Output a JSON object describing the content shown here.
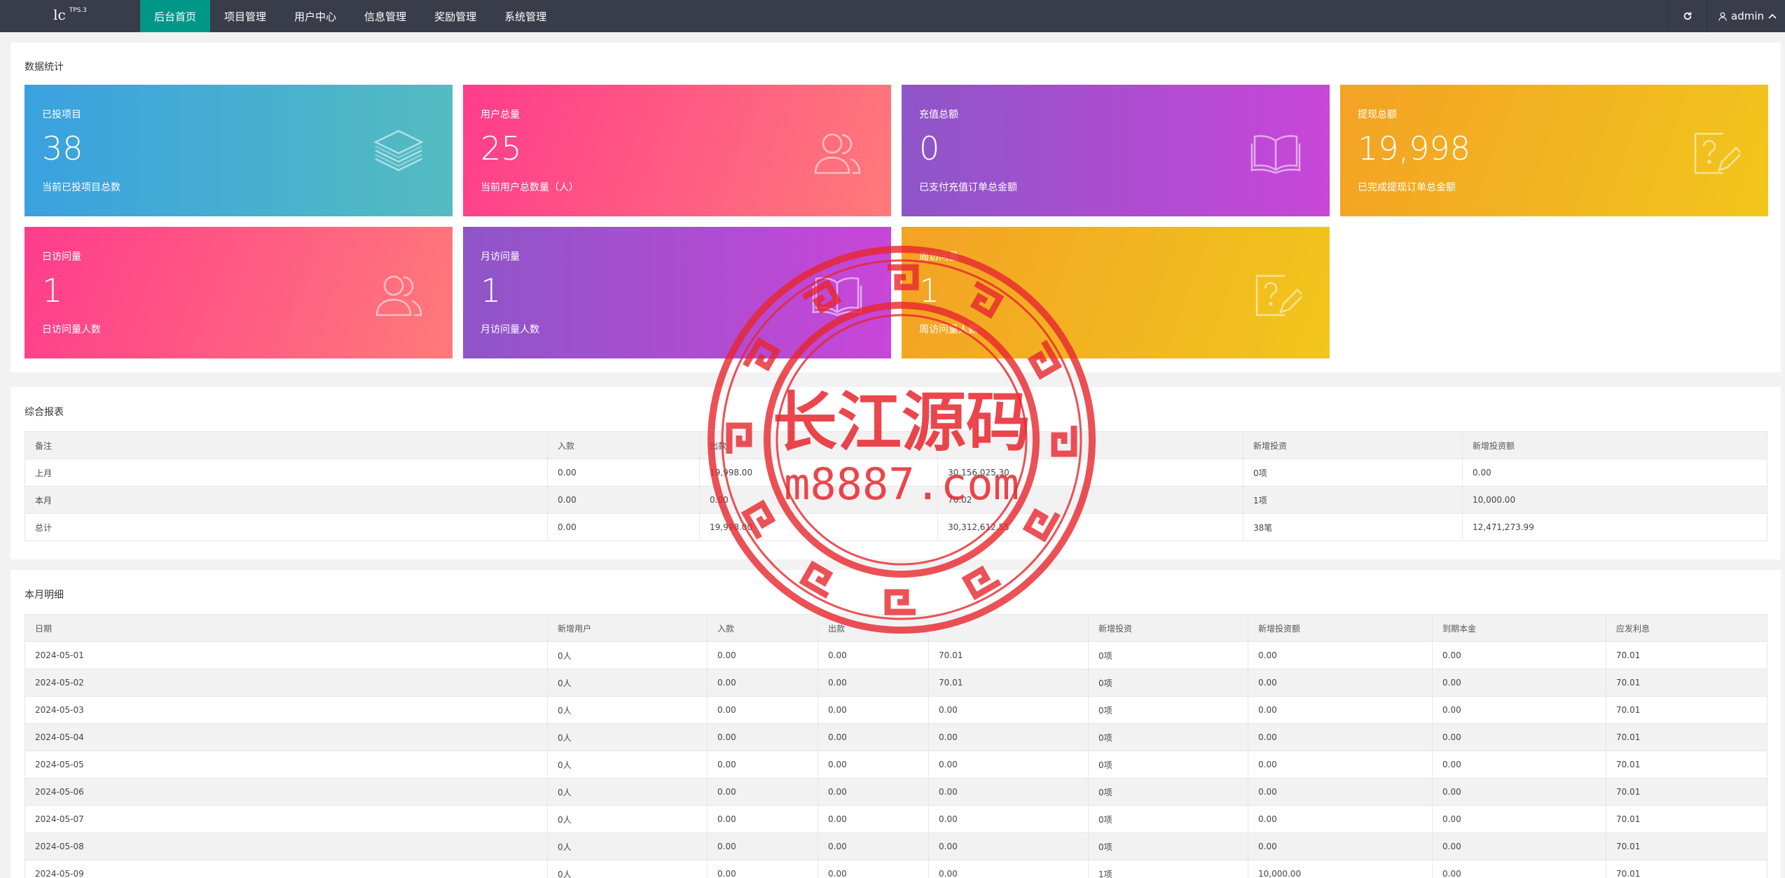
{
  "app": {
    "logo": "lc",
    "logo_sup": "TPS.3"
  },
  "nav": {
    "items": [
      "后台首页",
      "项目管理",
      "用户中心",
      "信息管理",
      "奖励管理",
      "系统管理"
    ]
  },
  "user": {
    "name": "admin"
  },
  "stats": {
    "title": "数据统计",
    "cards": [
      {
        "label": "已投项目",
        "value": "38",
        "desc": "当前已投项目总数"
      },
      {
        "label": "用户总量",
        "value": "25",
        "desc": "当前用户总数量（人）"
      },
      {
        "label": "充值总额",
        "value": "0",
        "desc": "已支付充值订单总金额"
      },
      {
        "label": "提现总额",
        "value": "19,998",
        "desc": "已完成提现订单总金额"
      },
      {
        "label": "日访问量",
        "value": "1",
        "desc": "日访问量人数"
      },
      {
        "label": "月访问量",
        "value": "1",
        "desc": "月访问量人数"
      },
      {
        "label": "周访问量",
        "value": "1",
        "desc": "周访问量人数"
      }
    ]
  },
  "report": {
    "title": "综合报表",
    "headers": [
      "备注",
      "入款",
      "出款",
      "",
      "新增投资",
      "新增投资额"
    ],
    "rows": [
      [
        "上月",
        "0.00",
        "19,998.00",
        "30,156,025.30",
        "0项",
        "0.00"
      ],
      [
        "本月",
        "0.00",
        "0.00",
        "70.02",
        "1项",
        "10,000.00"
      ],
      [
        "总计",
        "0.00",
        "19,998.00",
        "30,312,612.55",
        "38笔",
        "12,471,273.99"
      ]
    ]
  },
  "monthly": {
    "title": "本月明细",
    "headers": [
      "日期",
      "新增用户",
      "入款",
      "出款",
      "",
      "新增投资",
      "新增投资额",
      "到期本金",
      "应发利息"
    ],
    "rows": [
      [
        "2024-05-01",
        "0人",
        "0.00",
        "0.00",
        "70.01",
        "0项",
        "0.00",
        "0.00",
        "70.01"
      ],
      [
        "2024-05-02",
        "0人",
        "0.00",
        "0.00",
        "70.01",
        "0项",
        "0.00",
        "0.00",
        "70.01"
      ],
      [
        "2024-05-03",
        "0人",
        "0.00",
        "0.00",
        "0.00",
        "0项",
        "0.00",
        "0.00",
        "70.01"
      ],
      [
        "2024-05-04",
        "0人",
        "0.00",
        "0.00",
        "0.00",
        "0项",
        "0.00",
        "0.00",
        "70.01"
      ],
      [
        "2024-05-05",
        "0人",
        "0.00",
        "0.00",
        "0.00",
        "0项",
        "0.00",
        "0.00",
        "70.01"
      ],
      [
        "2024-05-06",
        "0人",
        "0.00",
        "0.00",
        "0.00",
        "0项",
        "0.00",
        "0.00",
        "70.01"
      ],
      [
        "2024-05-07",
        "0人",
        "0.00",
        "0.00",
        "0.00",
        "0项",
        "0.00",
        "0.00",
        "70.01"
      ],
      [
        "2024-05-08",
        "0人",
        "0.00",
        "0.00",
        "0.00",
        "0项",
        "0.00",
        "0.00",
        "70.01"
      ],
      [
        "2024-05-09",
        "0人",
        "0.00",
        "0.00",
        "0.00",
        "1项",
        "10,000.00",
        "0.00",
        "70.01"
      ]
    ]
  },
  "watermark": {
    "line1": "长江源码",
    "line2": "m8887.com"
  },
  "colors": {
    "topbar": "#393d49",
    "active": "#009688",
    "watermark": "#e8262d"
  }
}
